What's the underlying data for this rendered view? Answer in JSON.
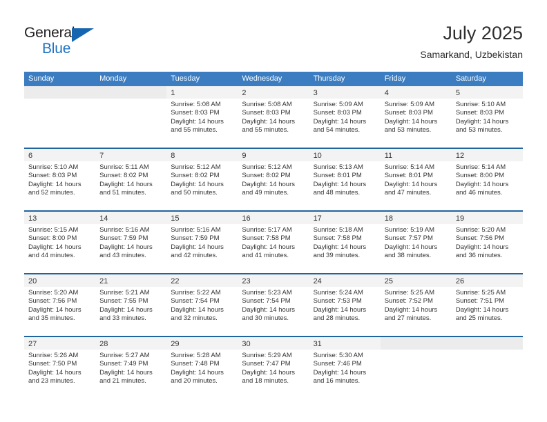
{
  "brand": {
    "name_part1": "General",
    "name_part2": "Blue",
    "triangle_color": "#1565b0",
    "blue_color": "#1d72c2"
  },
  "header": {
    "title": "July 2025",
    "subtitle": "Samarkand, Uzbekistan"
  },
  "theme": {
    "header_row_bg": "#3b7dc0",
    "row_divider": "#1f639f",
    "day_band_bg": "#f3f3f3",
    "day_band_bg_empty": "#ececec",
    "text": "#333333"
  },
  "weekdays": [
    "Sunday",
    "Monday",
    "Tuesday",
    "Wednesday",
    "Thursday",
    "Friday",
    "Saturday"
  ],
  "weeks": [
    [
      {
        "day": "",
        "sunrise": "",
        "sunset": "",
        "daylight1": "",
        "daylight2": "",
        "empty": true
      },
      {
        "day": "",
        "sunrise": "",
        "sunset": "",
        "daylight1": "",
        "daylight2": "",
        "empty": true
      },
      {
        "day": "1",
        "sunrise": "Sunrise: 5:08 AM",
        "sunset": "Sunset: 8:03 PM",
        "daylight1": "Daylight: 14 hours",
        "daylight2": "and 55 minutes."
      },
      {
        "day": "2",
        "sunrise": "Sunrise: 5:08 AM",
        "sunset": "Sunset: 8:03 PM",
        "daylight1": "Daylight: 14 hours",
        "daylight2": "and 55 minutes."
      },
      {
        "day": "3",
        "sunrise": "Sunrise: 5:09 AM",
        "sunset": "Sunset: 8:03 PM",
        "daylight1": "Daylight: 14 hours",
        "daylight2": "and 54 minutes."
      },
      {
        "day": "4",
        "sunrise": "Sunrise: 5:09 AM",
        "sunset": "Sunset: 8:03 PM",
        "daylight1": "Daylight: 14 hours",
        "daylight2": "and 53 minutes."
      },
      {
        "day": "5",
        "sunrise": "Sunrise: 5:10 AM",
        "sunset": "Sunset: 8:03 PM",
        "daylight1": "Daylight: 14 hours",
        "daylight2": "and 53 minutes."
      }
    ],
    [
      {
        "day": "6",
        "sunrise": "Sunrise: 5:10 AM",
        "sunset": "Sunset: 8:03 PM",
        "daylight1": "Daylight: 14 hours",
        "daylight2": "and 52 minutes."
      },
      {
        "day": "7",
        "sunrise": "Sunrise: 5:11 AM",
        "sunset": "Sunset: 8:02 PM",
        "daylight1": "Daylight: 14 hours",
        "daylight2": "and 51 minutes."
      },
      {
        "day": "8",
        "sunrise": "Sunrise: 5:12 AM",
        "sunset": "Sunset: 8:02 PM",
        "daylight1": "Daylight: 14 hours",
        "daylight2": "and 50 minutes."
      },
      {
        "day": "9",
        "sunrise": "Sunrise: 5:12 AM",
        "sunset": "Sunset: 8:02 PM",
        "daylight1": "Daylight: 14 hours",
        "daylight2": "and 49 minutes."
      },
      {
        "day": "10",
        "sunrise": "Sunrise: 5:13 AM",
        "sunset": "Sunset: 8:01 PM",
        "daylight1": "Daylight: 14 hours",
        "daylight2": "and 48 minutes."
      },
      {
        "day": "11",
        "sunrise": "Sunrise: 5:14 AM",
        "sunset": "Sunset: 8:01 PM",
        "daylight1": "Daylight: 14 hours",
        "daylight2": "and 47 minutes."
      },
      {
        "day": "12",
        "sunrise": "Sunrise: 5:14 AM",
        "sunset": "Sunset: 8:00 PM",
        "daylight1": "Daylight: 14 hours",
        "daylight2": "and 46 minutes."
      }
    ],
    [
      {
        "day": "13",
        "sunrise": "Sunrise: 5:15 AM",
        "sunset": "Sunset: 8:00 PM",
        "daylight1": "Daylight: 14 hours",
        "daylight2": "and 44 minutes."
      },
      {
        "day": "14",
        "sunrise": "Sunrise: 5:16 AM",
        "sunset": "Sunset: 7:59 PM",
        "daylight1": "Daylight: 14 hours",
        "daylight2": "and 43 minutes."
      },
      {
        "day": "15",
        "sunrise": "Sunrise: 5:16 AM",
        "sunset": "Sunset: 7:59 PM",
        "daylight1": "Daylight: 14 hours",
        "daylight2": "and 42 minutes."
      },
      {
        "day": "16",
        "sunrise": "Sunrise: 5:17 AM",
        "sunset": "Sunset: 7:58 PM",
        "daylight1": "Daylight: 14 hours",
        "daylight2": "and 41 minutes."
      },
      {
        "day": "17",
        "sunrise": "Sunrise: 5:18 AM",
        "sunset": "Sunset: 7:58 PM",
        "daylight1": "Daylight: 14 hours",
        "daylight2": "and 39 minutes."
      },
      {
        "day": "18",
        "sunrise": "Sunrise: 5:19 AM",
        "sunset": "Sunset: 7:57 PM",
        "daylight1": "Daylight: 14 hours",
        "daylight2": "and 38 minutes."
      },
      {
        "day": "19",
        "sunrise": "Sunrise: 5:20 AM",
        "sunset": "Sunset: 7:56 PM",
        "daylight1": "Daylight: 14 hours",
        "daylight2": "and 36 minutes."
      }
    ],
    [
      {
        "day": "20",
        "sunrise": "Sunrise: 5:20 AM",
        "sunset": "Sunset: 7:56 PM",
        "daylight1": "Daylight: 14 hours",
        "daylight2": "and 35 minutes."
      },
      {
        "day": "21",
        "sunrise": "Sunrise: 5:21 AM",
        "sunset": "Sunset: 7:55 PM",
        "daylight1": "Daylight: 14 hours",
        "daylight2": "and 33 minutes."
      },
      {
        "day": "22",
        "sunrise": "Sunrise: 5:22 AM",
        "sunset": "Sunset: 7:54 PM",
        "daylight1": "Daylight: 14 hours",
        "daylight2": "and 32 minutes."
      },
      {
        "day": "23",
        "sunrise": "Sunrise: 5:23 AM",
        "sunset": "Sunset: 7:54 PM",
        "daylight1": "Daylight: 14 hours",
        "daylight2": "and 30 minutes."
      },
      {
        "day": "24",
        "sunrise": "Sunrise: 5:24 AM",
        "sunset": "Sunset: 7:53 PM",
        "daylight1": "Daylight: 14 hours",
        "daylight2": "and 28 minutes."
      },
      {
        "day": "25",
        "sunrise": "Sunrise: 5:25 AM",
        "sunset": "Sunset: 7:52 PM",
        "daylight1": "Daylight: 14 hours",
        "daylight2": "and 27 minutes."
      },
      {
        "day": "26",
        "sunrise": "Sunrise: 5:25 AM",
        "sunset": "Sunset: 7:51 PM",
        "daylight1": "Daylight: 14 hours",
        "daylight2": "and 25 minutes."
      }
    ],
    [
      {
        "day": "27",
        "sunrise": "Sunrise: 5:26 AM",
        "sunset": "Sunset: 7:50 PM",
        "daylight1": "Daylight: 14 hours",
        "daylight2": "and 23 minutes."
      },
      {
        "day": "28",
        "sunrise": "Sunrise: 5:27 AM",
        "sunset": "Sunset: 7:49 PM",
        "daylight1": "Daylight: 14 hours",
        "daylight2": "and 21 minutes."
      },
      {
        "day": "29",
        "sunrise": "Sunrise: 5:28 AM",
        "sunset": "Sunset: 7:48 PM",
        "daylight1": "Daylight: 14 hours",
        "daylight2": "and 20 minutes."
      },
      {
        "day": "30",
        "sunrise": "Sunrise: 5:29 AM",
        "sunset": "Sunset: 7:47 PM",
        "daylight1": "Daylight: 14 hours",
        "daylight2": "and 18 minutes."
      },
      {
        "day": "31",
        "sunrise": "Sunrise: 5:30 AM",
        "sunset": "Sunset: 7:46 PM",
        "daylight1": "Daylight: 14 hours",
        "daylight2": "and 16 minutes."
      },
      {
        "day": "",
        "sunrise": "",
        "sunset": "",
        "daylight1": "",
        "daylight2": "",
        "empty": true
      },
      {
        "day": "",
        "sunrise": "",
        "sunset": "",
        "daylight1": "",
        "daylight2": "",
        "empty": true
      }
    ]
  ]
}
